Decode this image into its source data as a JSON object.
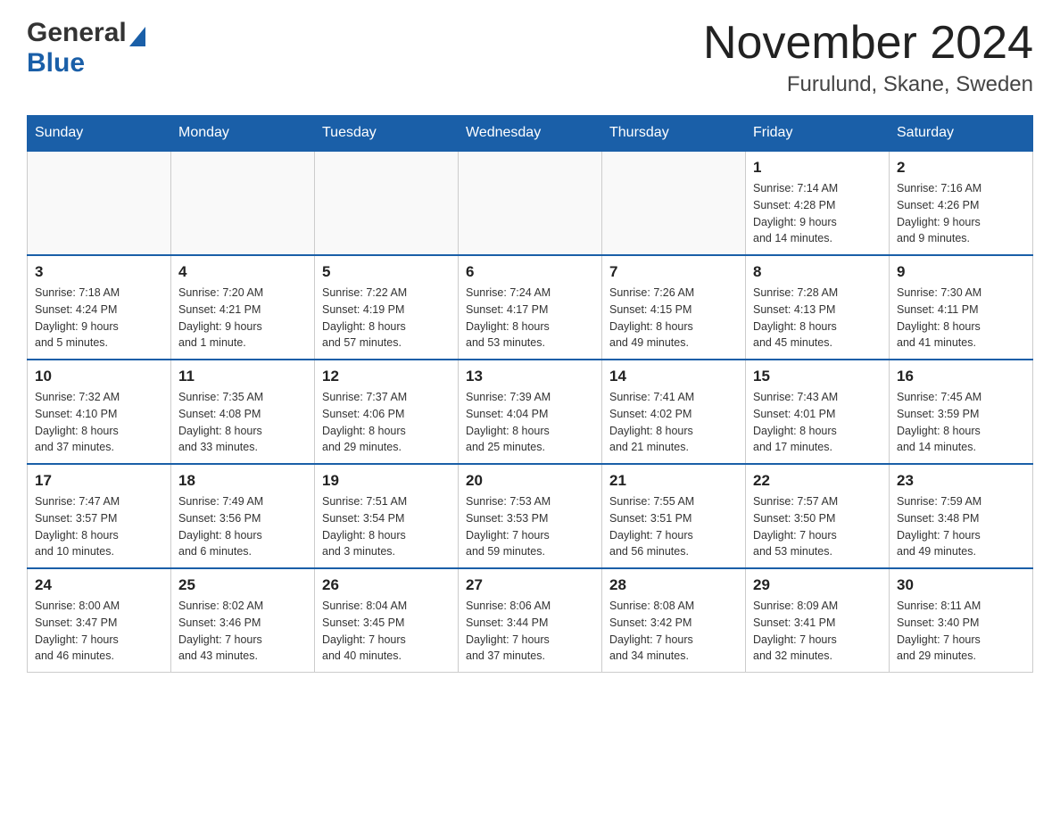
{
  "header": {
    "logo_general": "General",
    "logo_blue": "Blue",
    "month_title": "November 2024",
    "location": "Furulund, Skane, Sweden"
  },
  "weekdays": [
    "Sunday",
    "Monday",
    "Tuesday",
    "Wednesday",
    "Thursday",
    "Friday",
    "Saturday"
  ],
  "weeks": [
    [
      {
        "day": "",
        "info": ""
      },
      {
        "day": "",
        "info": ""
      },
      {
        "day": "",
        "info": ""
      },
      {
        "day": "",
        "info": ""
      },
      {
        "day": "",
        "info": ""
      },
      {
        "day": "1",
        "info": "Sunrise: 7:14 AM\nSunset: 4:28 PM\nDaylight: 9 hours\nand 14 minutes."
      },
      {
        "day": "2",
        "info": "Sunrise: 7:16 AM\nSunset: 4:26 PM\nDaylight: 9 hours\nand 9 minutes."
      }
    ],
    [
      {
        "day": "3",
        "info": "Sunrise: 7:18 AM\nSunset: 4:24 PM\nDaylight: 9 hours\nand 5 minutes."
      },
      {
        "day": "4",
        "info": "Sunrise: 7:20 AM\nSunset: 4:21 PM\nDaylight: 9 hours\nand 1 minute."
      },
      {
        "day": "5",
        "info": "Sunrise: 7:22 AM\nSunset: 4:19 PM\nDaylight: 8 hours\nand 57 minutes."
      },
      {
        "day": "6",
        "info": "Sunrise: 7:24 AM\nSunset: 4:17 PM\nDaylight: 8 hours\nand 53 minutes."
      },
      {
        "day": "7",
        "info": "Sunrise: 7:26 AM\nSunset: 4:15 PM\nDaylight: 8 hours\nand 49 minutes."
      },
      {
        "day": "8",
        "info": "Sunrise: 7:28 AM\nSunset: 4:13 PM\nDaylight: 8 hours\nand 45 minutes."
      },
      {
        "day": "9",
        "info": "Sunrise: 7:30 AM\nSunset: 4:11 PM\nDaylight: 8 hours\nand 41 minutes."
      }
    ],
    [
      {
        "day": "10",
        "info": "Sunrise: 7:32 AM\nSunset: 4:10 PM\nDaylight: 8 hours\nand 37 minutes."
      },
      {
        "day": "11",
        "info": "Sunrise: 7:35 AM\nSunset: 4:08 PM\nDaylight: 8 hours\nand 33 minutes."
      },
      {
        "day": "12",
        "info": "Sunrise: 7:37 AM\nSunset: 4:06 PM\nDaylight: 8 hours\nand 29 minutes."
      },
      {
        "day": "13",
        "info": "Sunrise: 7:39 AM\nSunset: 4:04 PM\nDaylight: 8 hours\nand 25 minutes."
      },
      {
        "day": "14",
        "info": "Sunrise: 7:41 AM\nSunset: 4:02 PM\nDaylight: 8 hours\nand 21 minutes."
      },
      {
        "day": "15",
        "info": "Sunrise: 7:43 AM\nSunset: 4:01 PM\nDaylight: 8 hours\nand 17 minutes."
      },
      {
        "day": "16",
        "info": "Sunrise: 7:45 AM\nSunset: 3:59 PM\nDaylight: 8 hours\nand 14 minutes."
      }
    ],
    [
      {
        "day": "17",
        "info": "Sunrise: 7:47 AM\nSunset: 3:57 PM\nDaylight: 8 hours\nand 10 minutes."
      },
      {
        "day": "18",
        "info": "Sunrise: 7:49 AM\nSunset: 3:56 PM\nDaylight: 8 hours\nand 6 minutes."
      },
      {
        "day": "19",
        "info": "Sunrise: 7:51 AM\nSunset: 3:54 PM\nDaylight: 8 hours\nand 3 minutes."
      },
      {
        "day": "20",
        "info": "Sunrise: 7:53 AM\nSunset: 3:53 PM\nDaylight: 7 hours\nand 59 minutes."
      },
      {
        "day": "21",
        "info": "Sunrise: 7:55 AM\nSunset: 3:51 PM\nDaylight: 7 hours\nand 56 minutes."
      },
      {
        "day": "22",
        "info": "Sunrise: 7:57 AM\nSunset: 3:50 PM\nDaylight: 7 hours\nand 53 minutes."
      },
      {
        "day": "23",
        "info": "Sunrise: 7:59 AM\nSunset: 3:48 PM\nDaylight: 7 hours\nand 49 minutes."
      }
    ],
    [
      {
        "day": "24",
        "info": "Sunrise: 8:00 AM\nSunset: 3:47 PM\nDaylight: 7 hours\nand 46 minutes."
      },
      {
        "day": "25",
        "info": "Sunrise: 8:02 AM\nSunset: 3:46 PM\nDaylight: 7 hours\nand 43 minutes."
      },
      {
        "day": "26",
        "info": "Sunrise: 8:04 AM\nSunset: 3:45 PM\nDaylight: 7 hours\nand 40 minutes."
      },
      {
        "day": "27",
        "info": "Sunrise: 8:06 AM\nSunset: 3:44 PM\nDaylight: 7 hours\nand 37 minutes."
      },
      {
        "day": "28",
        "info": "Sunrise: 8:08 AM\nSunset: 3:42 PM\nDaylight: 7 hours\nand 34 minutes."
      },
      {
        "day": "29",
        "info": "Sunrise: 8:09 AM\nSunset: 3:41 PM\nDaylight: 7 hours\nand 32 minutes."
      },
      {
        "day": "30",
        "info": "Sunrise: 8:11 AM\nSunset: 3:40 PM\nDaylight: 7 hours\nand 29 minutes."
      }
    ]
  ]
}
